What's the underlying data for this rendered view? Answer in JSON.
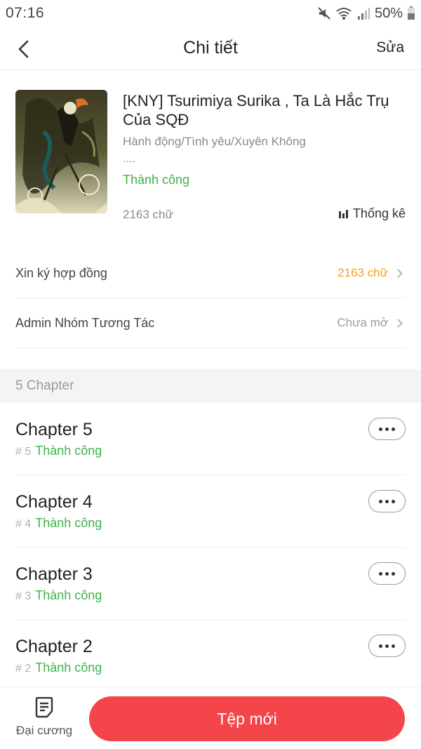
{
  "status_bar": {
    "time": "07:16",
    "battery": "50%"
  },
  "nav": {
    "title": "Chi tiết",
    "edit_label": "Sửa"
  },
  "book": {
    "title": "[KNY] Tsurimiya Surika , Ta Là Hắc Trụ Của SQĐ",
    "genres": "Hành động/Tình yêu/Xuyên Không",
    "summary": "....",
    "status": "Thành công",
    "word_count": "2163 chữ",
    "stats_label": "Thống kê"
  },
  "rows": [
    {
      "label": "Xin ký hợp đồng",
      "value": "2163 chữ",
      "value_color": "#f0a020"
    },
    {
      "label": "Admin Nhóm Tương Tác",
      "value": "Chưa mở",
      "value_color": "#9a9a9a"
    }
  ],
  "chapters_header": "5 Chapter",
  "chapters": [
    {
      "title": "Chapter 5",
      "number": "# 5",
      "status": "Thành công"
    },
    {
      "title": "Chapter 4",
      "number": "# 4",
      "status": "Thành công"
    },
    {
      "title": "Chapter 3",
      "number": "# 3",
      "status": "Thành công"
    },
    {
      "title": "Chapter 2",
      "number": "# 2",
      "status": "Thành công"
    }
  ],
  "bottom": {
    "outline_label": "Đại cương",
    "new_button": "Tệp mới"
  },
  "colors": {
    "accent": "#f4454a",
    "success": "#3cb34a",
    "warning": "#f0a020"
  }
}
